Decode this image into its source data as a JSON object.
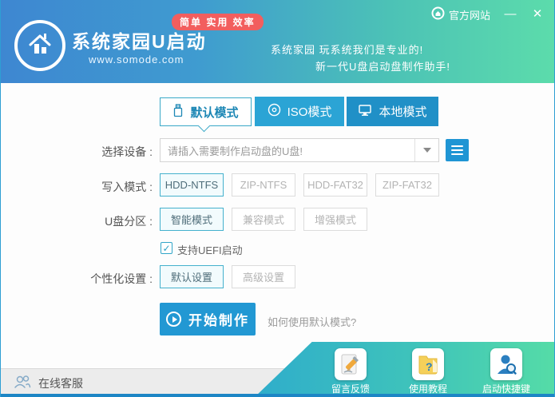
{
  "window": {
    "titlebar": {
      "official_site": "官方网站"
    },
    "header": {
      "badge": "简单 实用 效率",
      "app_name": "系统家园U启动",
      "website": "www.somode.com",
      "tagline1": "系统家园 玩系统我们是专业的!",
      "tagline2": "新一代U盘启动盘制作助手!"
    }
  },
  "icons": {
    "official_site": "circle-house",
    "minimize": "—",
    "close": "✕",
    "tab_default": "usb-drive",
    "tab_iso": "cd-disc",
    "tab_local": "monitor",
    "dropdown": "caret-down",
    "menu": "hamburger",
    "uefi_check": "✓",
    "start": "play-circle",
    "service": "two-persons",
    "feedback": "pencil-paper",
    "tutorial_question": "?",
    "hotkey": "person-magnifier"
  },
  "tabs": [
    {
      "label": "默认模式",
      "active": true
    },
    {
      "label": "ISO模式",
      "active": false
    },
    {
      "label": "本地模式",
      "active": false
    }
  ],
  "form": {
    "device": {
      "label": "选择设备 :",
      "placeholder": "请插入需要制作启动盘的U盘!"
    },
    "write_mode": {
      "label": "写入模式 :",
      "options": [
        "HDD-NTFS",
        "ZIP-NTFS",
        "HDD-FAT32",
        "ZIP-FAT32"
      ],
      "selected": "HDD-NTFS"
    },
    "partition": {
      "label": "U盘分区 :",
      "options": [
        "智能模式",
        "兼容模式",
        "增强模式"
      ],
      "selected": "智能模式"
    },
    "uefi": {
      "label": "支持UEFI启动",
      "checked": true
    },
    "personalize": {
      "label": "个性化设置 :",
      "options": [
        "默认设置",
        "高级设置"
      ],
      "selected": "默认设置"
    },
    "start_button": "开始制作",
    "help_link": "如何使用默认模式?"
  },
  "footer": {
    "online_service": "在线客服",
    "shortcuts": [
      {
        "label": "留言反馈"
      },
      {
        "label": "使用教程"
      },
      {
        "label": "启动快捷键"
      }
    ]
  },
  "colors": {
    "header_blue": "#3e87d1",
    "header_green": "#5cdcab",
    "badge_red": "#f25e5e",
    "tab_blue": "#2ba4d5",
    "tab_blue_dark": "#2090c7",
    "accent_blue": "#2298d3",
    "selected_border": "#44b1cd",
    "footer_teal": "#2fadcb",
    "footer_green": "#55dca7",
    "bottom_border": "#1d86c5"
  }
}
